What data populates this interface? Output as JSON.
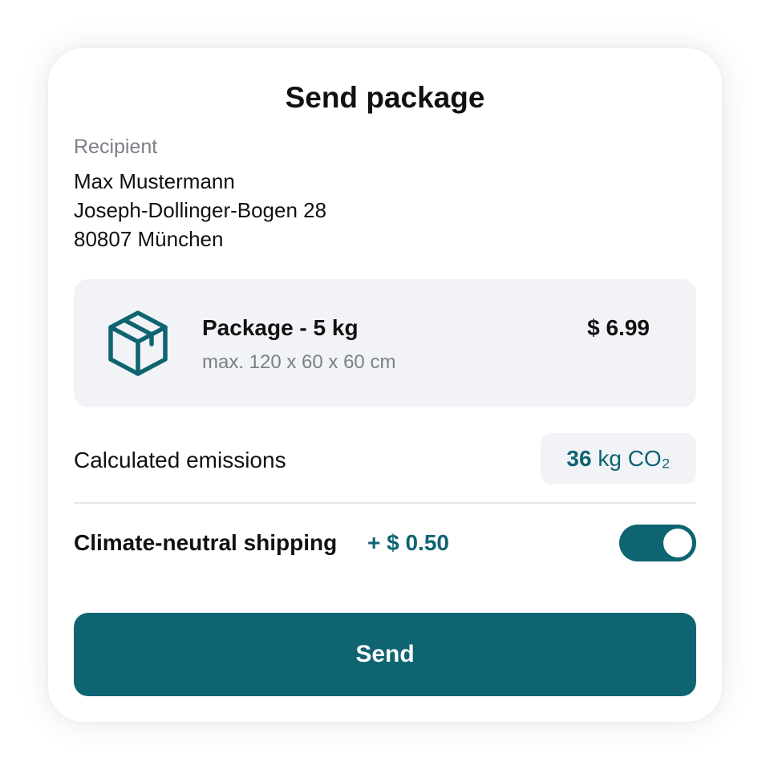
{
  "header": {
    "title": "Send package"
  },
  "recipient": {
    "label": "Recipient",
    "name": "Max Mustermann",
    "street": "Joseph-Dollinger-Bogen 28",
    "city": "80807 München"
  },
  "package": {
    "icon": "package-box-icon",
    "name": "Package - 5 kg",
    "dimensions": "max. 120 x 60 x 60 cm",
    "price": "$ 6.99"
  },
  "emissions": {
    "label": "Calculated emissions",
    "value": "36",
    "unit": "kg CO₂"
  },
  "climate": {
    "label": "Climate-neutral shipping",
    "price": "+ $ 0.50",
    "enabled": true
  },
  "actions": {
    "send_label": "Send"
  },
  "colors": {
    "accent": "#0f6472",
    "panel": "#f1f3f6",
    "muted_text": "#7b7f86",
    "text": "#111111"
  }
}
